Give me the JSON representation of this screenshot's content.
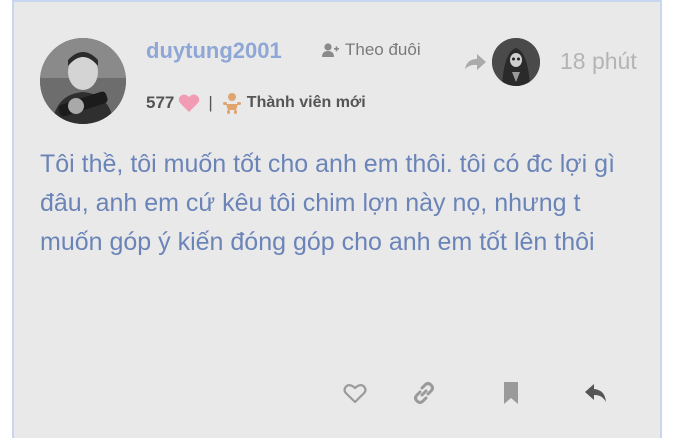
{
  "post": {
    "username": "duytung2001",
    "follow_label": "Theo đuôi",
    "time": "18 phút",
    "likes_count": "577",
    "user_title": "Thành viên mới",
    "body": "Tôi thề, tôi muốn tốt cho anh em thôi. tôi có đc lợi gì đâu, anh em cứ kêu tôi chim lợn này nọ, nhưng t muốn góp ý kiến đóng góp cho anh em tốt lên thôi"
  },
  "colors": {
    "username": "#8fa7d6",
    "body_text": "#6b84b8",
    "heart": "#f29bb4",
    "badge": "#e0a46f",
    "background": "#e9e9e9"
  },
  "icons": {
    "follow": "add-user-icon",
    "reply_to": "reply-arrow-icon",
    "like": "heart-outline-icon",
    "link": "link-icon",
    "bookmark": "bookmark-icon",
    "reply": "reply-icon",
    "badge": "baby-icon",
    "likes": "heart-icon"
  }
}
